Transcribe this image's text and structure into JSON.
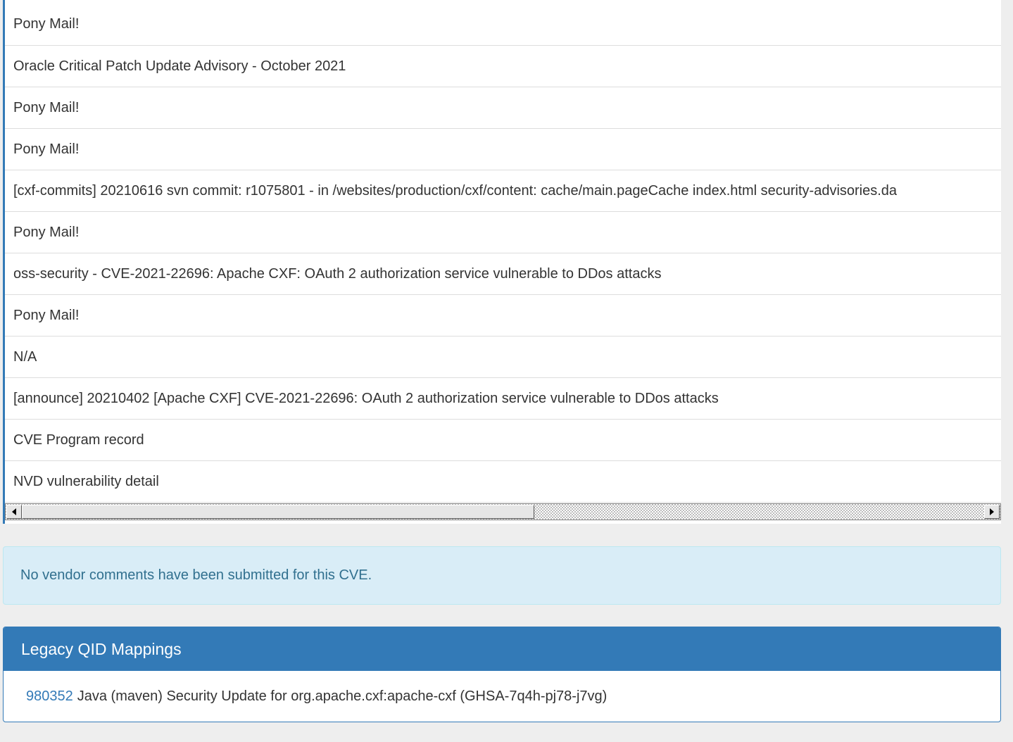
{
  "references": [
    "Pony Mail!",
    "Oracle Critical Patch Update Advisory - October 2021",
    "Pony Mail!",
    "Pony Mail!",
    "[cxf-commits] 20210616 svn commit: r1075801 - in /websites/production/cxf/content: cache/main.pageCache index.html security-advisories.da",
    "Pony Mail!",
    "oss-security - CVE-2021-22696: Apache CXF: OAuth 2 authorization service vulnerable to DDos attacks",
    "Pony Mail!",
    "N/A",
    "[announce] 20210402 [Apache CXF] CVE-2021-22696: OAuth 2 authorization service vulnerable to DDos attacks",
    "CVE Program record",
    "NVD vulnerability detail"
  ],
  "horizontal_scrollbar": {
    "left_arrow_icon": "triangle-left-icon",
    "right_arrow_icon": "triangle-right-icon",
    "thumb_fraction": 0.52
  },
  "vendor_comments": {
    "message": "No vendor comments have been submitted for this CVE."
  },
  "legacy_qid": {
    "title": "Legacy QID Mappings",
    "mappings": [
      {
        "qid": "980352",
        "description": "Java (maven) Security Update for org.apache.cxf:apache-cxf (GHSA-7q4h-pj78-j7vg)"
      }
    ]
  },
  "colors": {
    "accent": "#337ab7",
    "info_bg": "#d9edf7",
    "info_text": "#31708f",
    "page_bg": "#eeeeee"
  }
}
